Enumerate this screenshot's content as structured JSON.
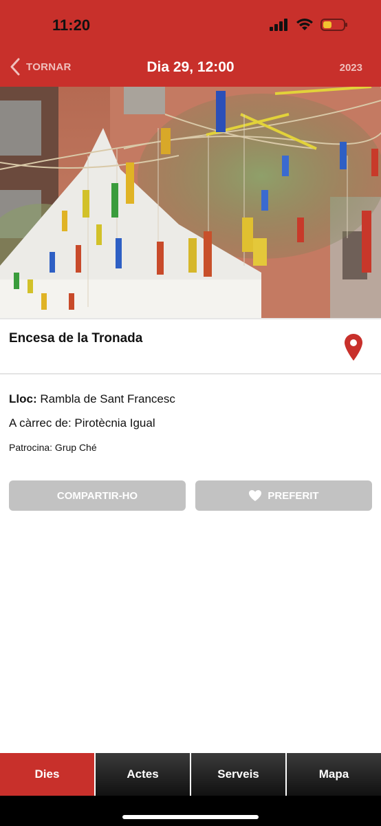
{
  "status_bar": {
    "time": "11:20"
  },
  "nav": {
    "back_label": "TORNAR",
    "title": "Dia 29, 12:00",
    "year": "2023"
  },
  "event": {
    "title": "Encesa de la Tronada",
    "place_label": "Lloc:",
    "place_value": "Rambla de Sant Francesc",
    "organizer": "A càrrec de: Pirotècnia Igual",
    "sponsor": "Patrocina: Grup Ché"
  },
  "actions": {
    "share_label": "COMPARTIR-HO",
    "favorite_label": "PREFERIT"
  },
  "tabs": [
    {
      "label": "Dies",
      "active": true
    },
    {
      "label": "Actes",
      "active": false
    },
    {
      "label": "Serveis",
      "active": false
    },
    {
      "label": "Mapa",
      "active": false
    }
  ],
  "colors": {
    "brand_red": "#c8302b",
    "button_gray": "#c2c2c2",
    "tabbar_dark": "#111111"
  },
  "icons": [
    "back-chevron-icon",
    "signal-icon",
    "wifi-icon",
    "battery-icon",
    "map-pin-icon",
    "heart-icon"
  ]
}
